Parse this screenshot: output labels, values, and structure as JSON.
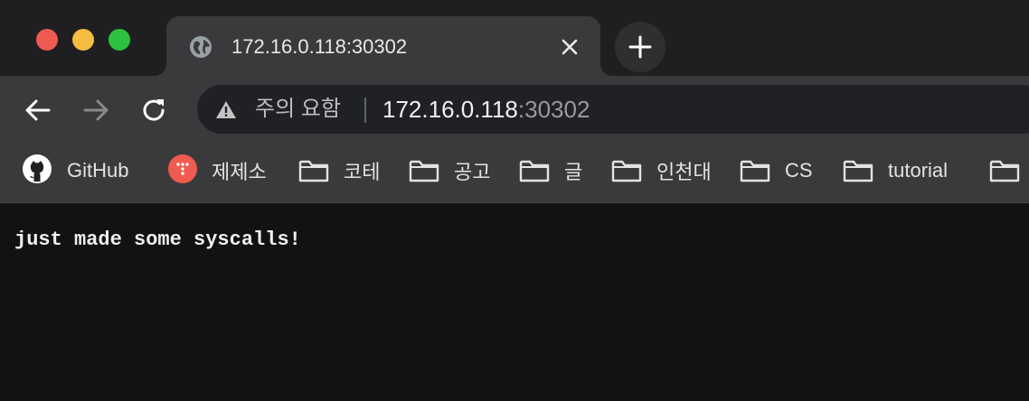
{
  "tab": {
    "title": "172.16.0.118:30302"
  },
  "address_bar": {
    "security_label": "주의 요함",
    "url_host": "172.16.0.118",
    "url_port": ":30302"
  },
  "bookmarks": [
    {
      "label": "GitHub",
      "icon": "github-icon"
    },
    {
      "label": "제제소",
      "icon": "red-dots-icon"
    },
    {
      "label": "코테",
      "icon": "folder-icon"
    },
    {
      "label": "공고",
      "icon": "folder-icon"
    },
    {
      "label": "글",
      "icon": "folder-icon"
    },
    {
      "label": "인천대",
      "icon": "folder-icon"
    },
    {
      "label": "CS",
      "icon": "folder-icon"
    },
    {
      "label": "tutorial",
      "icon": "folder-icon"
    },
    {
      "label": "",
      "icon": "folder-icon"
    }
  ],
  "page": {
    "body_text": "just made some syscalls!"
  },
  "colors": {
    "close_red": "#ee5a52",
    "minimize_yellow": "#f5be40",
    "zoom_green": "#2cc23d",
    "bookmark_red": "#ef5b4f"
  }
}
